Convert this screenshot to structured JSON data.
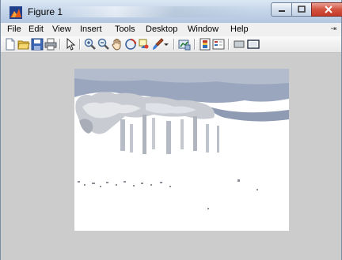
{
  "window": {
    "title": "Figure 1",
    "icon": "matlab-figure-icon"
  },
  "menu": {
    "items": [
      "File",
      "Edit",
      "View",
      "Insert",
      "Tools",
      "Desktop",
      "Window",
      "Help"
    ],
    "overflow_glyph": "⇥"
  },
  "toolbar": {
    "icons": [
      "new-figure-icon",
      "open-file-icon",
      "save-icon",
      "print-icon",
      "edit-plot-pointer-icon",
      "zoom-in-icon",
      "zoom-out-icon",
      "pan-hand-icon",
      "rotate-3d-icon",
      "data-cursor-icon",
      "brush-icon",
      "brush-dropdown-icon",
      "link-plot-icon",
      "colorbar-icon",
      "legend-icon",
      "hide-plot-tools-icon",
      "show-plot-tools-icon"
    ]
  },
  "figure": {
    "background_color": "#cccccc",
    "image_description_colors": [
      "#ffffff",
      "#9aa3b5",
      "#c7c8ce"
    ]
  }
}
